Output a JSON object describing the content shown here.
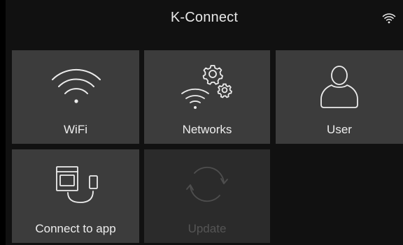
{
  "header": {
    "title": "K-Connect",
    "status_icon": "wifi-status-icon"
  },
  "tiles": [
    {
      "label": "WiFi",
      "icon": "wifi-icon",
      "enabled": true
    },
    {
      "label": "Networks",
      "icon": "networks-gears-icon",
      "enabled": true
    },
    {
      "label": "User",
      "icon": "user-icon",
      "enabled": true
    },
    {
      "label": "Connect to app",
      "icon": "oven-phone-icon",
      "enabled": true
    },
    {
      "label": "Update",
      "icon": "refresh-icon",
      "enabled": false
    }
  ],
  "colors": {
    "background": "#111111",
    "tile": "#3c3c3c",
    "tile_disabled": "#2b2b2b",
    "text": "#ececec",
    "text_disabled": "#555555"
  }
}
